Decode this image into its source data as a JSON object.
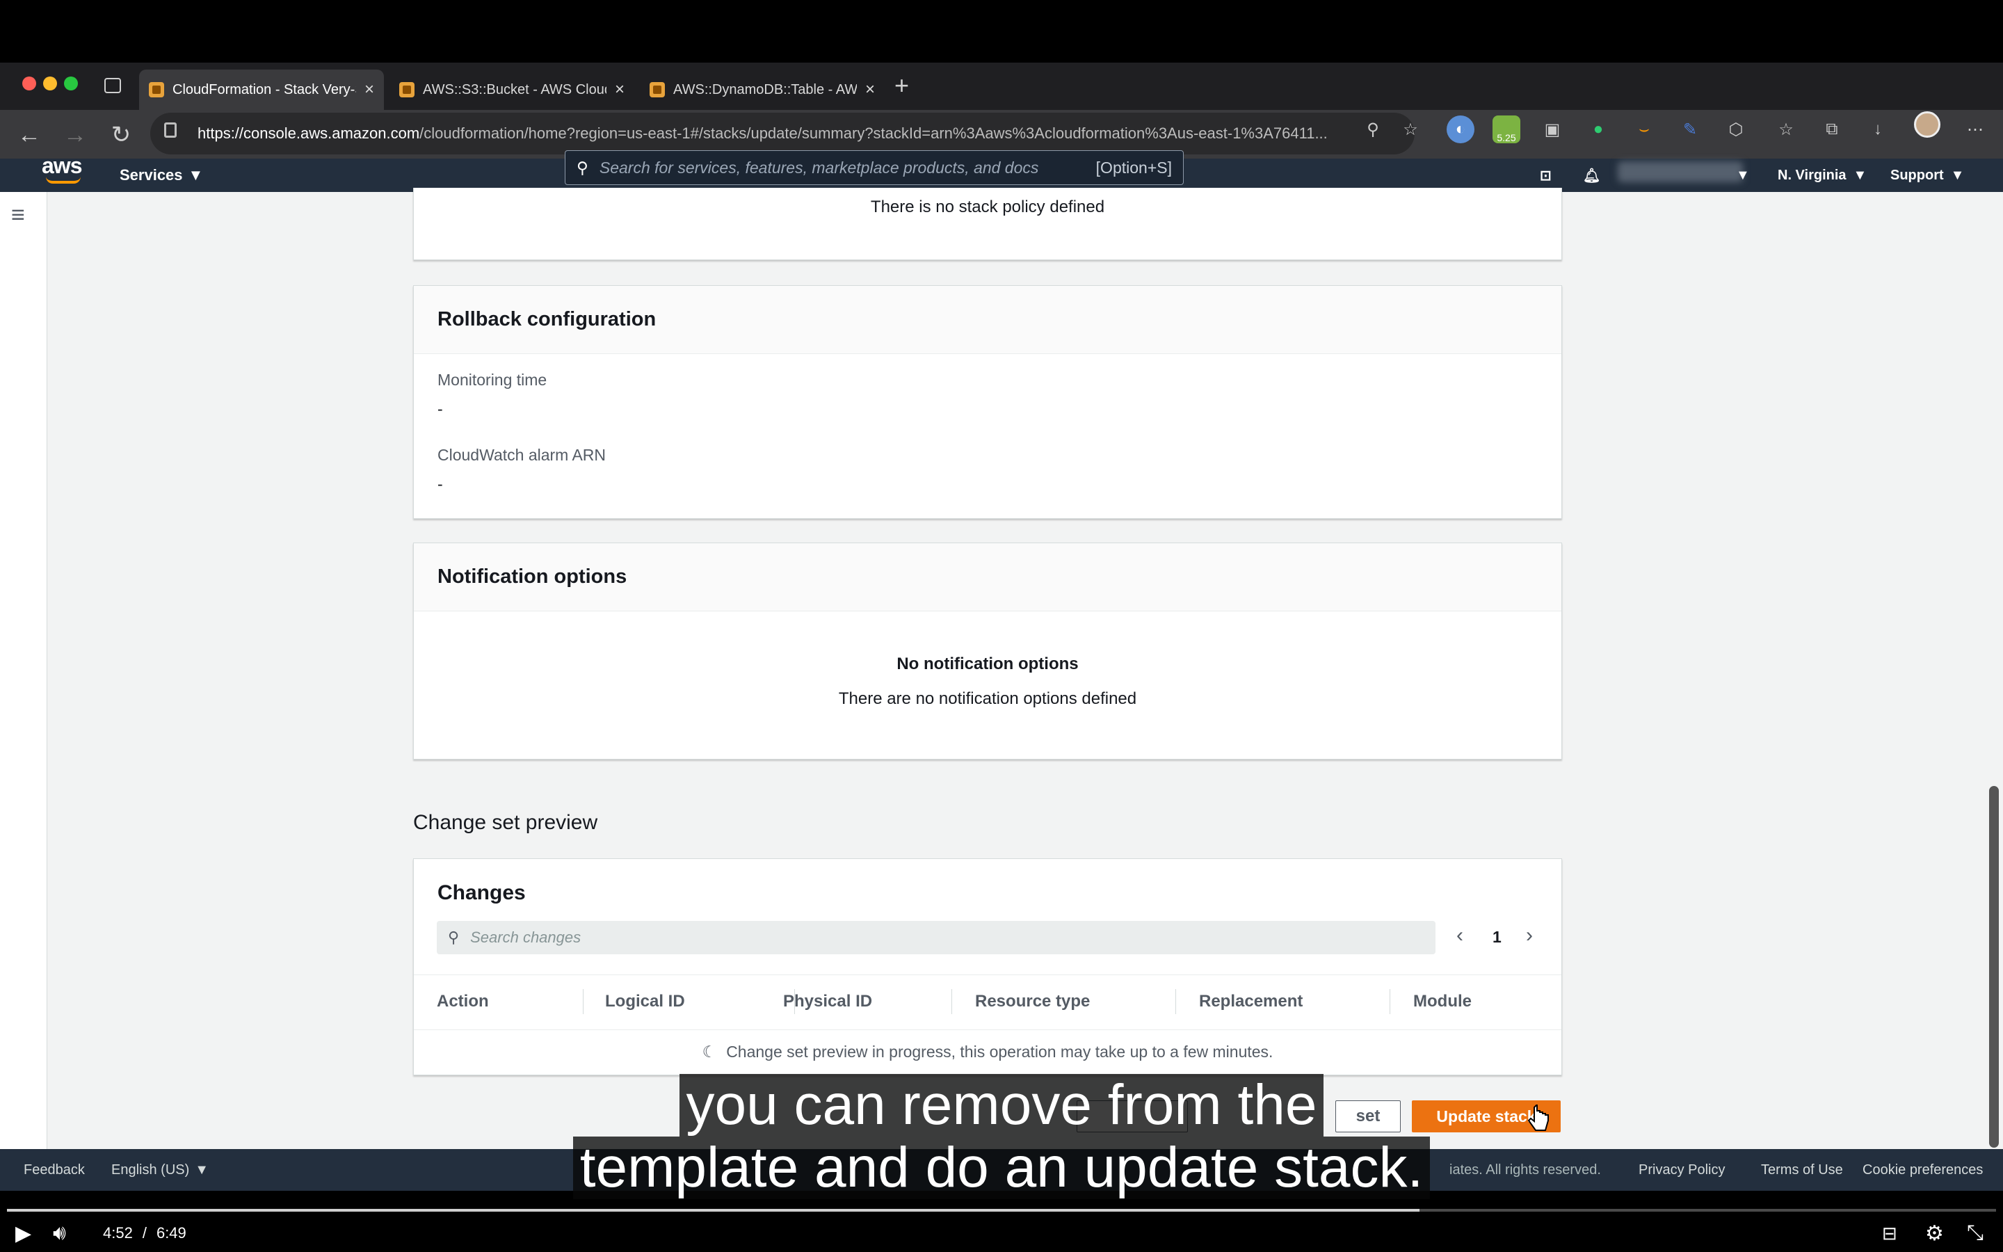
{
  "browser": {
    "tabs": [
      {
        "title": "CloudFormation - Stack Very-S",
        "active": true
      },
      {
        "title": "AWS::S3::Bucket - AWS Cloud",
        "active": false
      },
      {
        "title": "AWS::DynamoDB::Table - AWS",
        "active": false
      }
    ],
    "url_host": "https://console.aws.amazon.com",
    "url_path": "/cloudformation/home?region=us-east-1#/stacks/update/summary?stackId=arn%3Aaws%3Acloudformation%3Aus-east-1%3A76411...",
    "badge_count": "5.25"
  },
  "aws_header": {
    "logo": "aws",
    "services_label": "Services",
    "search_placeholder": "Search for services, features, marketplace products, and docs",
    "search_shortcut": "[Option+S]",
    "region": "N. Virginia",
    "support": "Support"
  },
  "stack_policy": {
    "message": "There is no stack policy defined"
  },
  "rollback": {
    "title": "Rollback configuration",
    "monitoring_label": "Monitoring time",
    "monitoring_value": "-",
    "alarm_label": "CloudWatch alarm ARN",
    "alarm_value": "-"
  },
  "notification": {
    "title": "Notification options",
    "empty_title": "No notification options",
    "empty_text": "There are no notification options defined"
  },
  "change_set": {
    "section_title": "Change set preview",
    "panel_title": "Changes",
    "search_placeholder": "Search changes",
    "page_number": "1",
    "columns": [
      "Action",
      "Logical ID",
      "Physical ID",
      "Resource type",
      "Replacement",
      "Module"
    ],
    "progress_message": "Change set preview in progress, this operation may take up to a few minutes."
  },
  "actions": {
    "change_set_partial": "set",
    "update_stack": "Update stack"
  },
  "footer": {
    "feedback": "Feedback",
    "language": "English (US)",
    "copyright_partial": "iates. All rights reserved.",
    "privacy": "Privacy Policy",
    "terms": "Terms of Use",
    "cookies": "Cookie preferences"
  },
  "subtitle": {
    "line1": "you can remove from the",
    "line2": "template and do an update stack."
  },
  "player": {
    "current_time": "4:52",
    "separator": "/",
    "duration": "6:49",
    "progress_fraction": 0.71
  },
  "colors": {
    "aws_nav": "#232f3e",
    "update_button": "#ec7211",
    "aws_orange": "#ff9900"
  }
}
